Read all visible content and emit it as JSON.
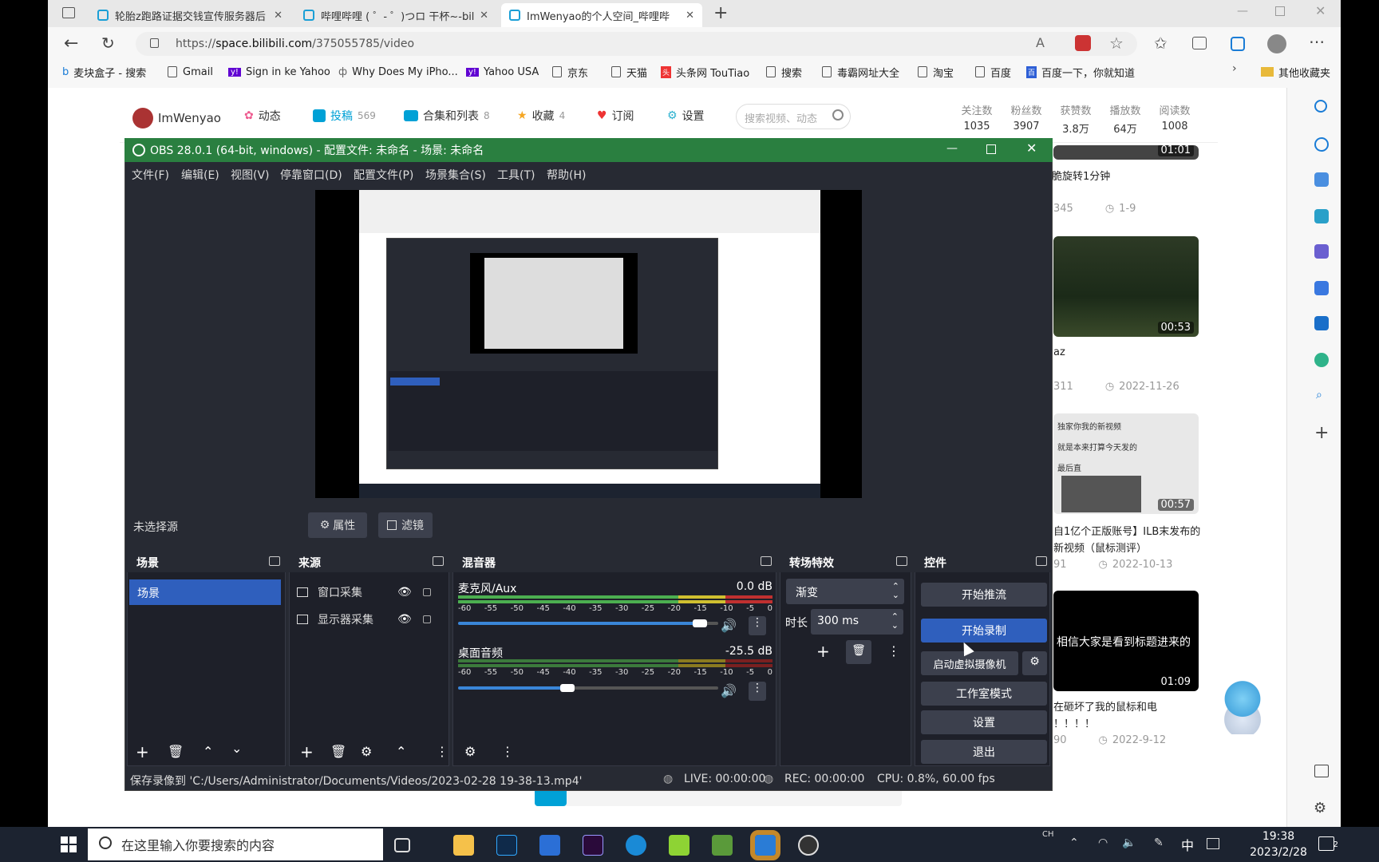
{
  "browser": {
    "tabs": [
      {
        "label": "轮胎z跑路证据交钱宣传服务器后"
      },
      {
        "label": "哔哩哔哩 ( ゜- ゜)つロ 干杯~-bili"
      },
      {
        "label": "ImWenyao的个人空间_哔哩哔"
      }
    ],
    "url_prefix": "https://",
    "url_domain": "space.bilibili.com",
    "url_path": "/375055785/video",
    "bookmarks": [
      "麦块盒子 - 搜索",
      "Gmail",
      "Sign in ke Yahoo",
      "Why Does My iPho...",
      "Yahoo USA",
      "京东",
      "天猫",
      "头条网 TouTiao",
      "搜索",
      "毒霸网址大全",
      "淘宝",
      "百度",
      "百度一下，你就知道"
    ],
    "other_bookmarks": "其他收藏夹"
  },
  "bili": {
    "username": "ImWenyao",
    "nav": [
      {
        "label": "动态",
        "count": ""
      },
      {
        "label": "投稿",
        "count": "569"
      },
      {
        "label": "合集和列表",
        "count": "8"
      },
      {
        "label": "收藏",
        "count": "4"
      },
      {
        "label": "订阅",
        "count": ""
      },
      {
        "label": "设置",
        "count": ""
      }
    ],
    "search_placeholder": "搜索视频、动态",
    "stats": [
      {
        "label": "关注数",
        "value": "1035"
      },
      {
        "label": "粉丝数",
        "value": "3907"
      },
      {
        "label": "获赞数",
        "value": "3.8万"
      },
      {
        "label": "播放数",
        "value": "64万"
      },
      {
        "label": "阅读数",
        "value": "1008"
      }
    ],
    "videos": [
      {
        "duration": "01:01",
        "title": "脆旋转1分钟",
        "views": "345",
        "date": "1-9"
      },
      {
        "duration": "00:53",
        "title": "az",
        "views": "311",
        "date": "2022-11-26"
      },
      {
        "duration": "00:57",
        "title": "自1亿个正版账号】ILB末发布的\n新视频（鼠标测评）",
        "views": "91",
        "date": "2022-10-13",
        "thumb_text": [
          "独家你我的新视频",
          "就是本来打算今天发的",
          "最后直"
        ]
      },
      {
        "duration": "01:09",
        "title": "在砸坏了我的鼠标和电\n！！！！",
        "views": "90",
        "date": "2022-9-12",
        "thumb_text": [
          "相信大家是看到标题进来的"
        ]
      }
    ]
  },
  "obs": {
    "title": "OBS 28.0.1 (64-bit, windows) - 配置文件: 未命名 - 场景: 未命名",
    "menu": [
      "文件(F)",
      "编辑(E)",
      "视图(V)",
      "停靠窗口(D)",
      "配置文件(P)",
      "场景集合(S)",
      "工具(T)",
      "帮助(H)"
    ],
    "no_source": "未选择源",
    "properties": "属性",
    "filters": "滤镜",
    "panels": {
      "scenes": "场景",
      "sources": "来源",
      "mixer": "混音器",
      "transitions": "转场特效",
      "controls": "控件"
    },
    "scene_items": [
      "场景"
    ],
    "source_items": [
      "窗口采集",
      "显示器采集"
    ],
    "mixer": [
      {
        "name": "麦克风/Aux",
        "db": "0.0 dB",
        "level": 0.93
      },
      {
        "name": "桌面音频",
        "db": "-25.5 dB",
        "level": 0.42
      }
    ],
    "mixer_ticks": [
      "-60",
      "-55",
      "-50",
      "-45",
      "-40",
      "-35",
      "-30",
      "-25",
      "-20",
      "-15",
      "-10",
      "-5",
      "0"
    ],
    "transition": "渐变",
    "duration_label": "时长",
    "duration_value": "300 ms",
    "controls": {
      "stream": "开始推流",
      "record": "开始录制",
      "virtualcam": "启动虚拟摄像机",
      "studio": "工作室模式",
      "settings": "设置",
      "exit": "退出"
    },
    "status": {
      "saved": "保存录像到 'C:/Users/Administrator/Documents/Videos/2023-02-28 19-38-13.mp4'",
      "live": "LIVE: 00:00:00",
      "rec": "REC: 00:00:00",
      "cpu": "CPU: 0.8%, 60.00 fps"
    }
  },
  "taskbar": {
    "search_placeholder": "在这里输入你要搜索的内容",
    "ime_top": "CH",
    "ime": "中",
    "time": "19:38",
    "date": "2023/2/28",
    "notif": "2"
  }
}
